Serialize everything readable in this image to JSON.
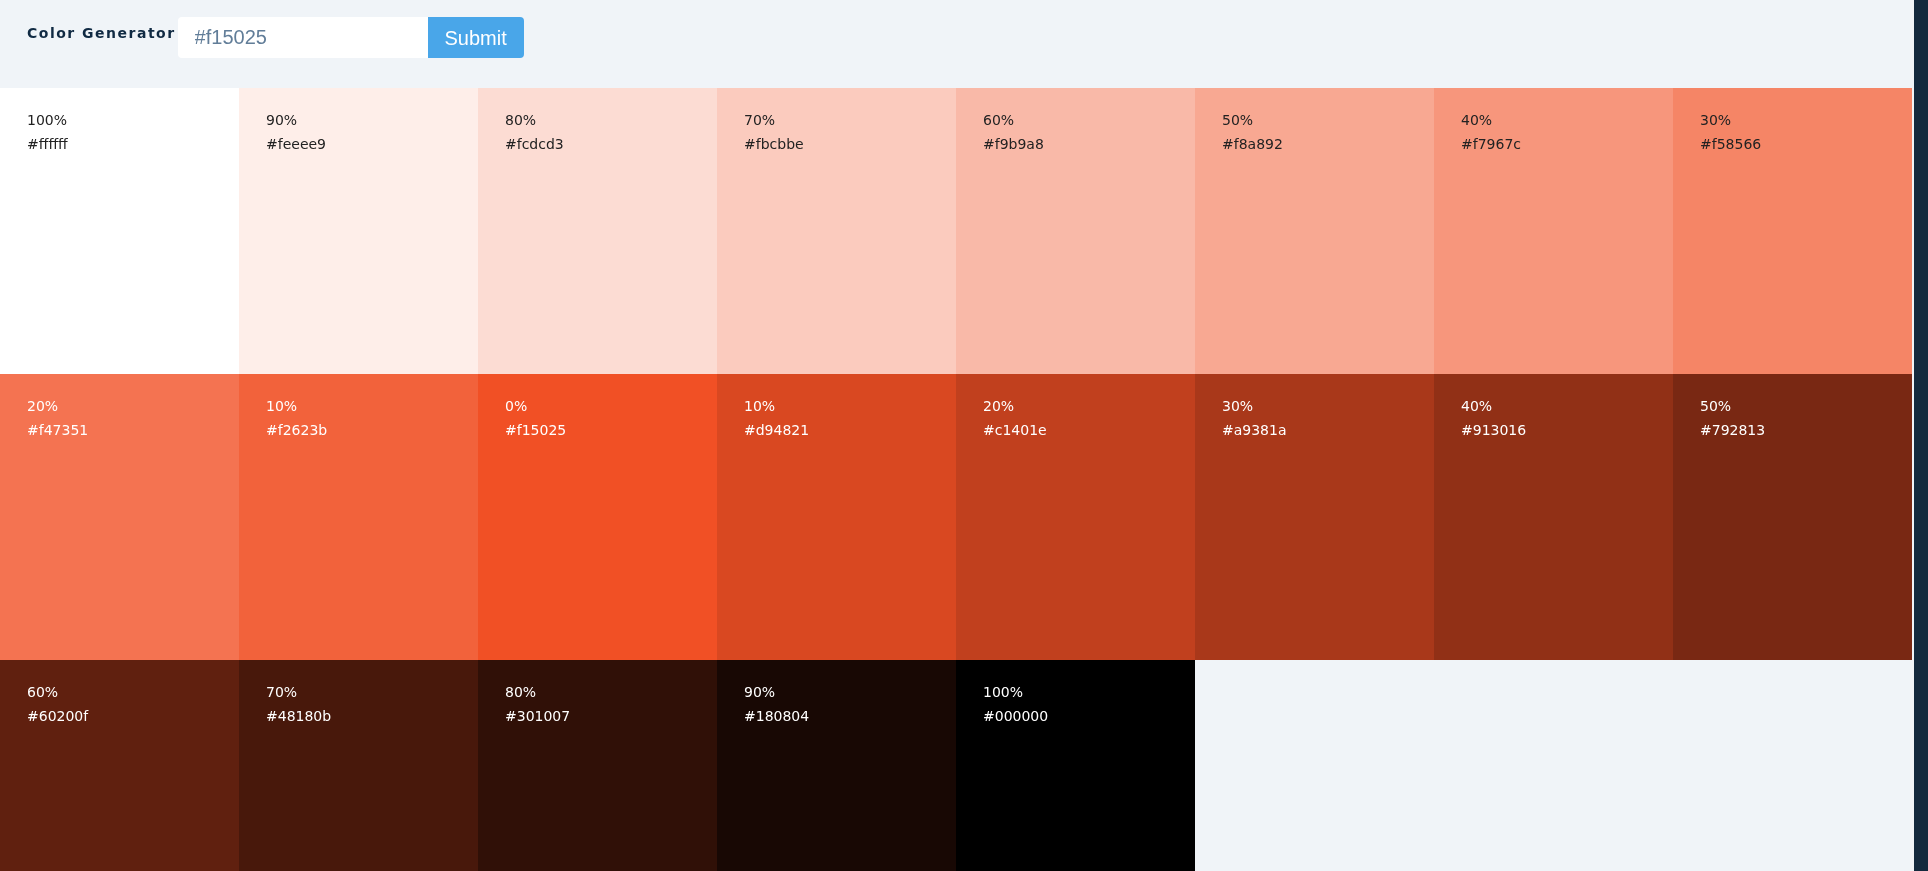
{
  "header": {
    "title": "Color Generator",
    "input": {
      "value": "#f15025"
    },
    "submit_button": "Submit"
  },
  "swatches": [
    {
      "percent": "100%",
      "hex": "#ffffff",
      "color": "#ffffff",
      "kind": "pale"
    },
    {
      "percent": "90%",
      "hex": "#feeee9",
      "color": "#feeee9",
      "kind": "pale"
    },
    {
      "percent": "80%",
      "hex": "#fcdcd3",
      "color": "#fcdcd3",
      "kind": "pale"
    },
    {
      "percent": "70%",
      "hex": "#fbcbbe",
      "color": "#fbcbbe",
      "kind": "pale"
    },
    {
      "percent": "60%",
      "hex": "#f9b9a8",
      "color": "#f9b9a8",
      "kind": "pale"
    },
    {
      "percent": "50%",
      "hex": "#f8a892",
      "color": "#f8a892",
      "kind": "pale"
    },
    {
      "percent": "40%",
      "hex": "#f7967c",
      "color": "#f7967c",
      "kind": "pale"
    },
    {
      "percent": "30%",
      "hex": "#f58566",
      "color": "#f58566",
      "kind": "pale"
    },
    {
      "percent": "20%",
      "hex": "#f47351",
      "color": "#f47351",
      "kind": "deep"
    },
    {
      "percent": "10%",
      "hex": "#f2623b",
      "color": "#f2623b",
      "kind": "deep"
    },
    {
      "percent": "0%",
      "hex": "#f15025",
      "color": "#f15025",
      "kind": "deep"
    },
    {
      "percent": "10%",
      "hex": "#d94821",
      "color": "#d94821",
      "kind": "deep"
    },
    {
      "percent": "20%",
      "hex": "#c1401e",
      "color": "#c1401e",
      "kind": "deep"
    },
    {
      "percent": "30%",
      "hex": "#a9381a",
      "color": "#a9381a",
      "kind": "deep"
    },
    {
      "percent": "40%",
      "hex": "#913016",
      "color": "#913016",
      "kind": "deep"
    },
    {
      "percent": "50%",
      "hex": "#792813",
      "color": "#792813",
      "kind": "deep"
    },
    {
      "percent": "60%",
      "hex": "#60200f",
      "color": "#60200f",
      "kind": "deep"
    },
    {
      "percent": "70%",
      "hex": "#48180b",
      "color": "#48180b",
      "kind": "deep"
    },
    {
      "percent": "80%",
      "hex": "#301007",
      "color": "#301007",
      "kind": "deep"
    },
    {
      "percent": "90%",
      "hex": "#180804",
      "color": "#180804",
      "kind": "deep"
    },
    {
      "percent": "100%",
      "hex": "#000000",
      "color": "#000000",
      "kind": "deep"
    }
  ]
}
